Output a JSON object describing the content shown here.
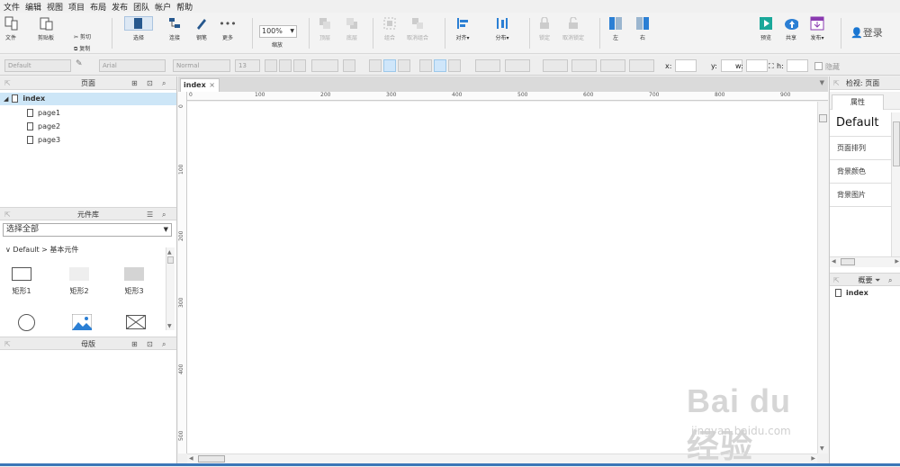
{
  "menu": [
    "文件",
    "编辑",
    "视图",
    "项目",
    "布局",
    "发布",
    "团队",
    "帐户",
    "帮助"
  ],
  "toolbar": {
    "file": "文件",
    "clipboard": "剪贴板",
    "cut": "剪切",
    "copy": "复制",
    "select": "选择",
    "connect": "连接",
    "pen": "钢笔",
    "more": "更多",
    "zoom_value": "100%",
    "zoom_label": "缩放",
    "top": "顶层",
    "bottom": "底层",
    "group": "组合",
    "ungroup": "取消组合",
    "align": "对齐",
    "distribute": "分布",
    "lock": "锁定",
    "unlock": "取消锁定",
    "left": "左",
    "right": "右",
    "preview": "预览",
    "share": "共享",
    "publish": "发布",
    "login": "登录"
  },
  "format": {
    "style": "Default",
    "font": "Arial",
    "weight": "Normal",
    "size": "13",
    "x_label": "x:",
    "y_label": "y:",
    "w_label": "w:",
    "h_label": "h:",
    "hidden": "隐藏"
  },
  "pages_panel": {
    "title": "页面",
    "root": "index",
    "children": [
      "page1",
      "page2",
      "page3"
    ]
  },
  "library_panel": {
    "title": "元件库",
    "select_value": "选择全部",
    "category": "Default > 基本元件",
    "widgets": [
      "矩形1",
      "矩形2",
      "矩形3"
    ]
  },
  "masters_panel": {
    "title": "母版"
  },
  "tab": {
    "label": "index"
  },
  "ruler": {
    "h_ticks": [
      "0",
      "100",
      "200",
      "300",
      "400",
      "500",
      "600",
      "700",
      "800",
      "900"
    ],
    "v_ticks": [
      "0",
      "100",
      "200",
      "300",
      "400",
      "500"
    ]
  },
  "inspector": {
    "title": "检视: 页面",
    "tab": "属性",
    "style_name": "Default",
    "items": [
      "页面排列",
      "背景颜色",
      "背景图片"
    ]
  },
  "outline": {
    "title": "概要",
    "item": "index"
  },
  "watermark": {
    "brand": "Bai du 经验",
    "url": "jingyan.baidu.com"
  },
  "colors": {
    "accent": "#2b7fd4",
    "selected_row": "#cde6f7",
    "preview": "#1aa89a",
    "publish": "#8a3ab0"
  }
}
